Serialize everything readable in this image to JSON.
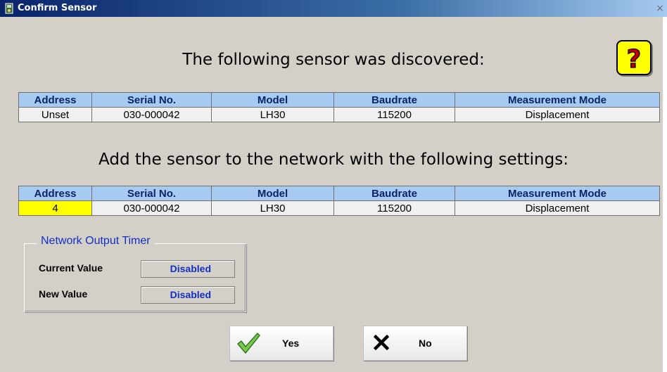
{
  "window": {
    "title": "Confirm Sensor",
    "close_symbol": "×",
    "icon": "sensor-app-icon"
  },
  "discovered": {
    "heading": "The following sensor was discovered:",
    "columns": [
      "Address",
      "Serial No.",
      "Model",
      "Baudrate",
      "Measurement Mode"
    ],
    "row": [
      "Unset",
      "030-000042",
      "LH30",
      "115200",
      "Displacement"
    ]
  },
  "settings": {
    "heading": "Add the sensor to the network with the following settings:",
    "columns": [
      "Address",
      "Serial No.",
      "Model",
      "Baudrate",
      "Measurement Mode"
    ],
    "row": [
      "4",
      "030-000042",
      "LH30",
      "115200",
      "Displacement"
    ],
    "highlight_color": "#ffff00"
  },
  "network_output_timer": {
    "title": "Network Output Timer",
    "current_label": "Current Value",
    "current_value": "Disabled",
    "new_label": "New Value",
    "new_value": "Disabled"
  },
  "buttons": {
    "yes_label": "Yes",
    "yes_icon": "checkmark-icon",
    "no_label": "No",
    "no_icon": "x-icon"
  },
  "help": {
    "icon": "question-mark-icon"
  },
  "colors": {
    "header_bg": "#a6caf0",
    "header_text": "#0a246a",
    "accent_blue": "#1030c8",
    "help_bg": "#ffff00"
  }
}
